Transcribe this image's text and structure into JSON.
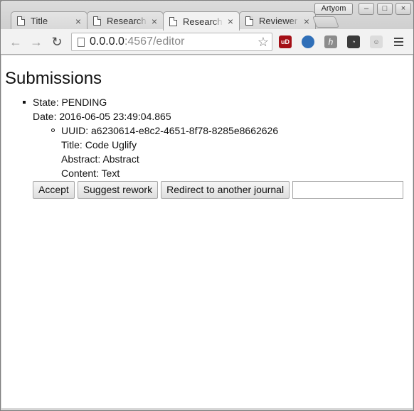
{
  "window": {
    "profile_name": "Artyom",
    "controls": {
      "minimize": "–",
      "maximize": "□",
      "close": "×"
    }
  },
  "tabs": [
    {
      "label": "Title",
      "active": false
    },
    {
      "label": "Research",
      "active": false
    },
    {
      "label": "Research",
      "active": true
    },
    {
      "label": "Reviewer",
      "active": false
    }
  ],
  "toolbar": {
    "back_icon": "arrow-left-icon",
    "forward_icon": "arrow-right-icon",
    "reload_icon": "reload-icon",
    "url_host": "0.0.0.0",
    "url_rest": ":4567/editor",
    "bookmark_icon": "star-icon",
    "extensions": [
      {
        "name": "ublock-icon",
        "text": "uD",
        "color": "#a40f16"
      },
      {
        "name": "globe-icon",
        "text": "",
        "color": "#2f6fb8"
      },
      {
        "name": "hypothesis-icon",
        "text": "h",
        "color": "#8c8c8c"
      },
      {
        "name": "lightbulb-icon",
        "text": "",
        "color": "#3a3a3a"
      },
      {
        "name": "ghost-icon",
        "text": "",
        "color": "#dcdcdc"
      }
    ],
    "menu_icon": "hamburger-menu-icon"
  },
  "page": {
    "title": "Submissions",
    "submissions": [
      {
        "state": "State: PENDING",
        "date": "Date: 2016-06-05 23:49:04.865",
        "papers": [
          {
            "uuid": "UUID: a6230614-e8c2-4651-8f78-8285e8662626",
            "title": "Title: Code Uglify",
            "abstract": "Abstract: Abstract",
            "content": "Content: Text"
          }
        ],
        "actions": {
          "accept": "Accept",
          "suggest_rework": "Suggest rework",
          "redirect": "Redirect to another journal",
          "journal_input_value": ""
        }
      }
    ]
  }
}
